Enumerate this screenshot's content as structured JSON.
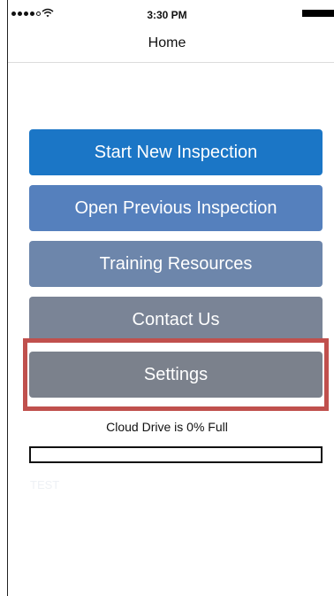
{
  "status_bar": {
    "time": "3:30 PM",
    "signal_dots_filled": 4,
    "signal_dots_total": 5
  },
  "nav": {
    "title": "Home"
  },
  "menu": {
    "items": [
      {
        "label": "Start New Inspection",
        "color": "#1b76c6"
      },
      {
        "label": "Open Previous Inspection",
        "color": "#5580bd"
      },
      {
        "label": "Training Resources",
        "color": "#6d86ab"
      },
      {
        "label": "Contact Us",
        "color": "#7a8496"
      },
      {
        "label": "Settings",
        "color": "#7b818c"
      }
    ]
  },
  "highlight": {
    "target": "Settings",
    "color": "#c0504d"
  },
  "storage": {
    "label": "Cloud Drive is 0% Full",
    "fill_percent": 0
  },
  "footer": {
    "test_label": "TEST"
  }
}
